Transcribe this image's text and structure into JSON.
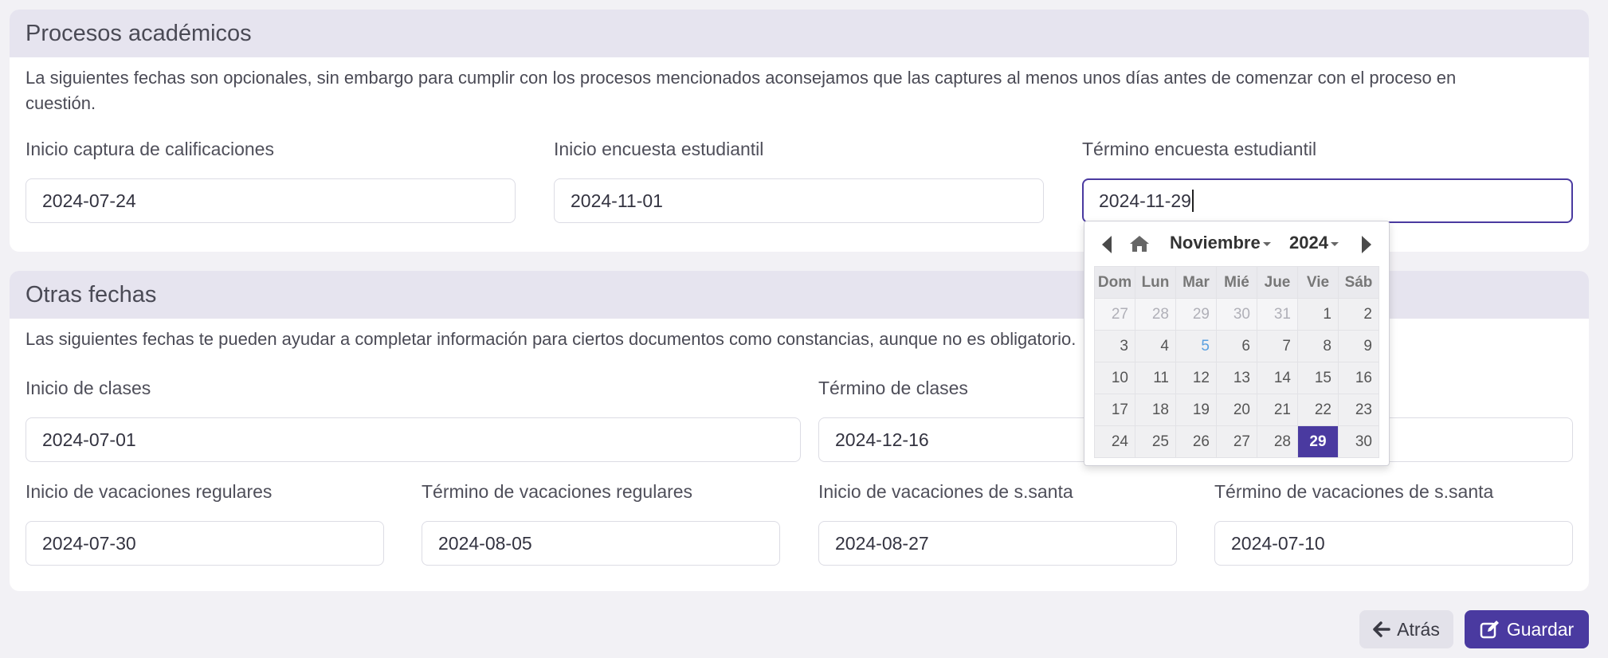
{
  "academic": {
    "title": "Procesos académicos",
    "description": "La siguientes fechas son opcionales, sin embargo para cumplir con los procesos mencionados aconsejamos que las captures al menos unos días antes de comenzar con el proceso en cuestión.",
    "fields": [
      {
        "label": "Inicio captura de calificaciones",
        "value": "2024-07-24"
      },
      {
        "label": "Inicio encuesta estudiantil",
        "value": "2024-11-01"
      },
      {
        "label": "Término encuesta estudiantil",
        "value": "2024-11-29"
      }
    ]
  },
  "other": {
    "title": "Otras fechas",
    "description": "Las siguientes fechas te pueden ayudar a completar información para ciertos documentos como constancias, aunque no es obligatorio.",
    "fields": [
      {
        "label": "Inicio de clases",
        "value": "2024-07-01"
      },
      {
        "label": "Término de clases",
        "value": "2024-12-16"
      },
      {
        "label": "Inicio de vacaciones regulares",
        "value": "2024-07-30"
      },
      {
        "label": "Término de vacaciones regulares",
        "value": "2024-08-05"
      },
      {
        "label": "Inicio de vacaciones de s.santa",
        "value": "2024-08-27"
      },
      {
        "label": "Término de vacaciones de s.santa",
        "value": "2024-07-10"
      }
    ]
  },
  "picker": {
    "month": "Noviembre",
    "year": "2024",
    "weekdays": [
      "Dom",
      "Lun",
      "Mar",
      "Mié",
      "Jue",
      "Vie",
      "Sáb"
    ],
    "weeks": [
      [
        "27",
        "28",
        "29",
        "30",
        "31",
        "1",
        "2"
      ],
      [
        "3",
        "4",
        "5",
        "6",
        "7",
        "8",
        "9"
      ],
      [
        "10",
        "11",
        "12",
        "13",
        "14",
        "15",
        "16"
      ],
      [
        "17",
        "18",
        "19",
        "20",
        "21",
        "22",
        "23"
      ],
      [
        "24",
        "25",
        "26",
        "27",
        "28",
        "29",
        "30"
      ]
    ],
    "today": "5",
    "selected": "29"
  },
  "buttons": {
    "back": "Atrás",
    "save": "Guardar"
  },
  "colors": {
    "accent": "#4a3aa0",
    "header_bg": "#e6e4ef"
  }
}
